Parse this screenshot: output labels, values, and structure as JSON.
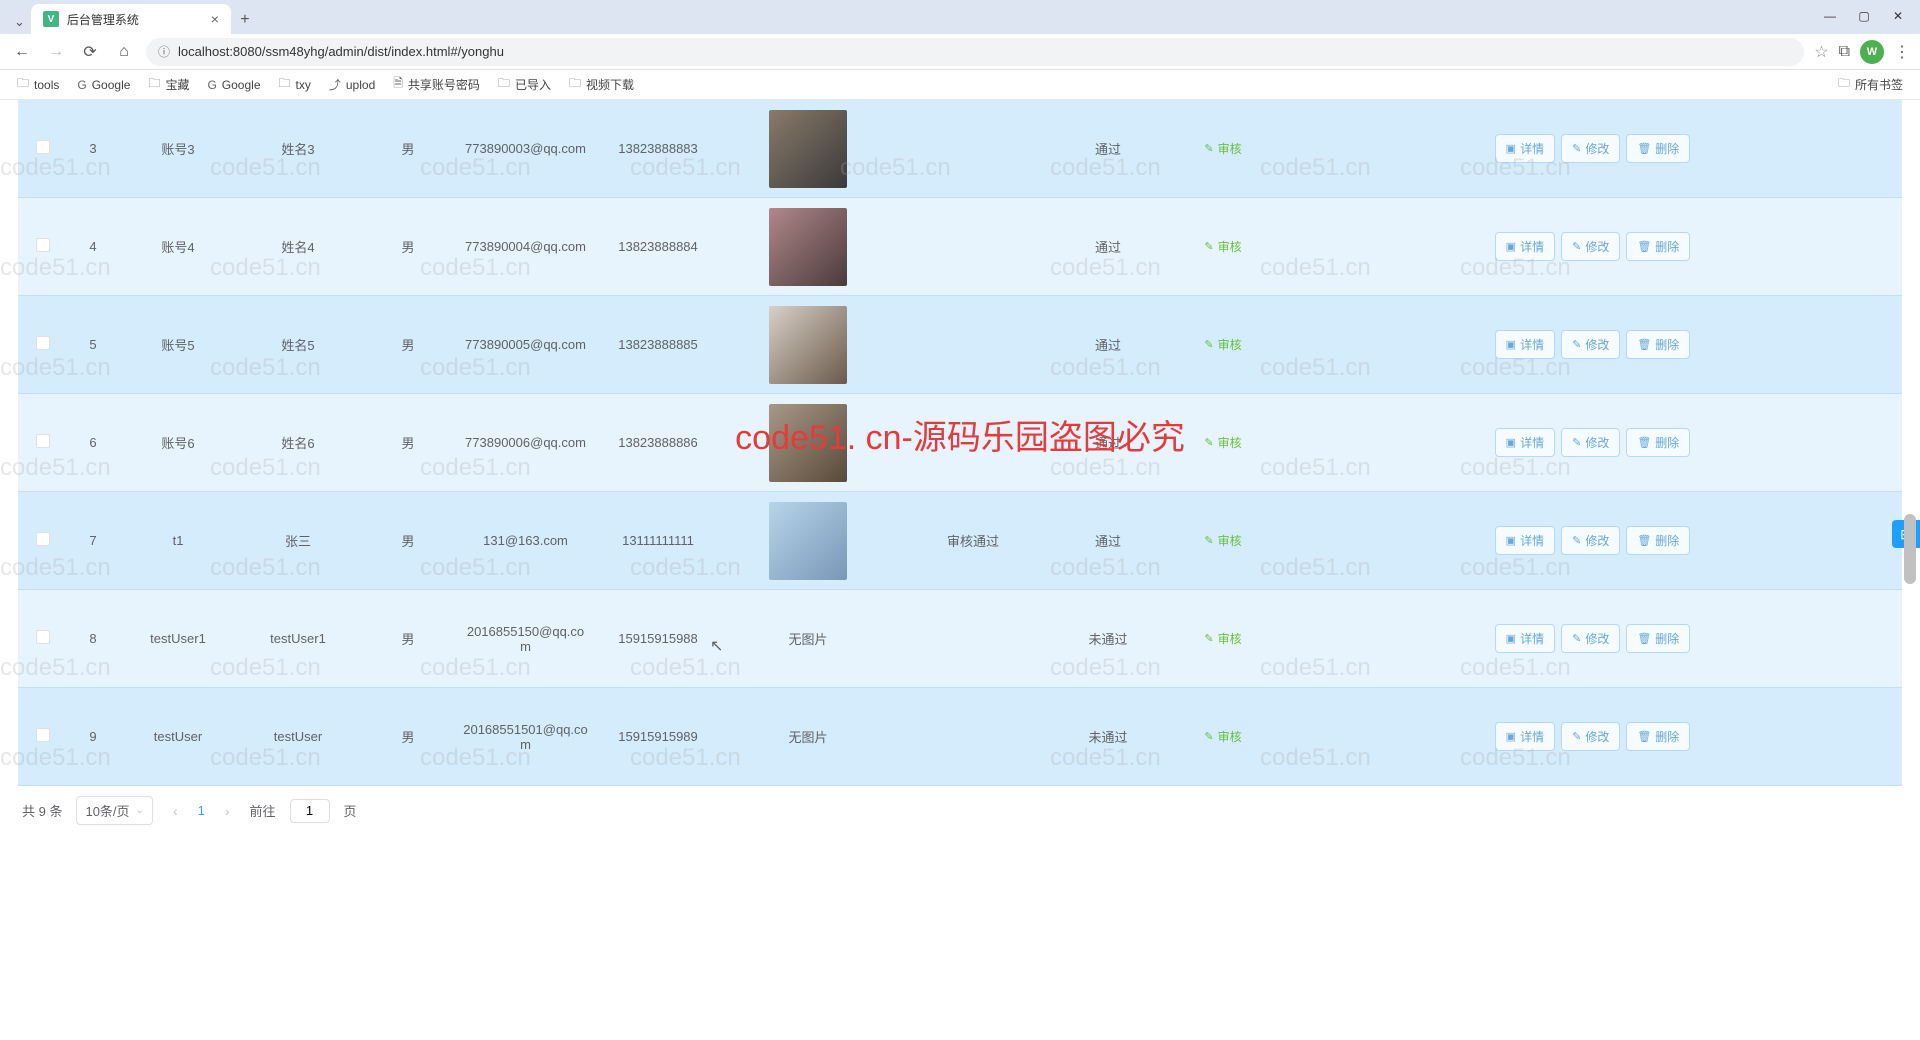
{
  "browser": {
    "tab_title": "后台管理系统",
    "url": "localhost:8080/ssm48yhg/admin/dist/index.html#/yonghu",
    "profile_initial": "W",
    "bookmarks": [
      {
        "label": "tools",
        "icon": "folder"
      },
      {
        "label": "Google",
        "icon": "google"
      },
      {
        "label": "宝藏",
        "icon": "folder"
      },
      {
        "label": "Google",
        "icon": "google"
      },
      {
        "label": "txy",
        "icon": "folder"
      },
      {
        "label": "uplod",
        "icon": "upload"
      },
      {
        "label": "共享账号密码",
        "icon": "doc"
      },
      {
        "label": "已导入",
        "icon": "folder"
      },
      {
        "label": "视频下载",
        "icon": "folder"
      }
    ],
    "bookmarks_right": {
      "label": "所有书签",
      "icon": "folder"
    }
  },
  "watermark": "code51.cn",
  "center_watermark": "code51. cn-源码乐园盗图必究",
  "actions": {
    "detail": "详情",
    "edit": "修改",
    "delete": "删除",
    "review": "审核"
  },
  "rows": [
    {
      "idx": "3",
      "account": "账号3",
      "name": "姓名3",
      "gender": "男",
      "email": "773890003@qq.com",
      "phone": "13823888883",
      "avatar": "p1",
      "audit": "",
      "status": "通过",
      "alt": false
    },
    {
      "idx": "4",
      "account": "账号4",
      "name": "姓名4",
      "gender": "男",
      "email": "773890004@qq.com",
      "phone": "13823888884",
      "avatar": "p2",
      "audit": "",
      "status": "通过",
      "alt": true
    },
    {
      "idx": "5",
      "account": "账号5",
      "name": "姓名5",
      "gender": "男",
      "email": "773890005@qq.com",
      "phone": "13823888885",
      "avatar": "p3",
      "audit": "",
      "status": "通过",
      "alt": false
    },
    {
      "idx": "6",
      "account": "账号6",
      "name": "姓名6",
      "gender": "男",
      "email": "773890006@qq.com",
      "phone": "13823888886",
      "avatar": "p4",
      "audit": "",
      "status": "通过",
      "alt": true
    },
    {
      "idx": "7",
      "account": "t1",
      "name": "张三",
      "gender": "男",
      "email": "131@163.com",
      "phone": "13111111111",
      "avatar": "p5",
      "audit": "审核通过",
      "status": "通过",
      "alt": false
    },
    {
      "idx": "8",
      "account": "testUser1",
      "name": "testUser1",
      "gender": "男",
      "email": "2016855150@qq.com",
      "phone": "15915915988",
      "avatar": "",
      "no_image": "无图片",
      "audit": "",
      "status": "未通过",
      "alt": true
    },
    {
      "idx": "9",
      "account": "testUser",
      "name": "testUser",
      "gender": "男",
      "email": "20168551501@qq.com",
      "phone": "15915915989",
      "avatar": "",
      "no_image": "无图片",
      "audit": "",
      "status": "未通过",
      "alt": false
    }
  ],
  "pagination": {
    "total_text": "共 9 条",
    "page_size": "10条/页",
    "current": "1",
    "goto_prefix": "前往",
    "goto_value": "1",
    "goto_suffix": "页"
  }
}
